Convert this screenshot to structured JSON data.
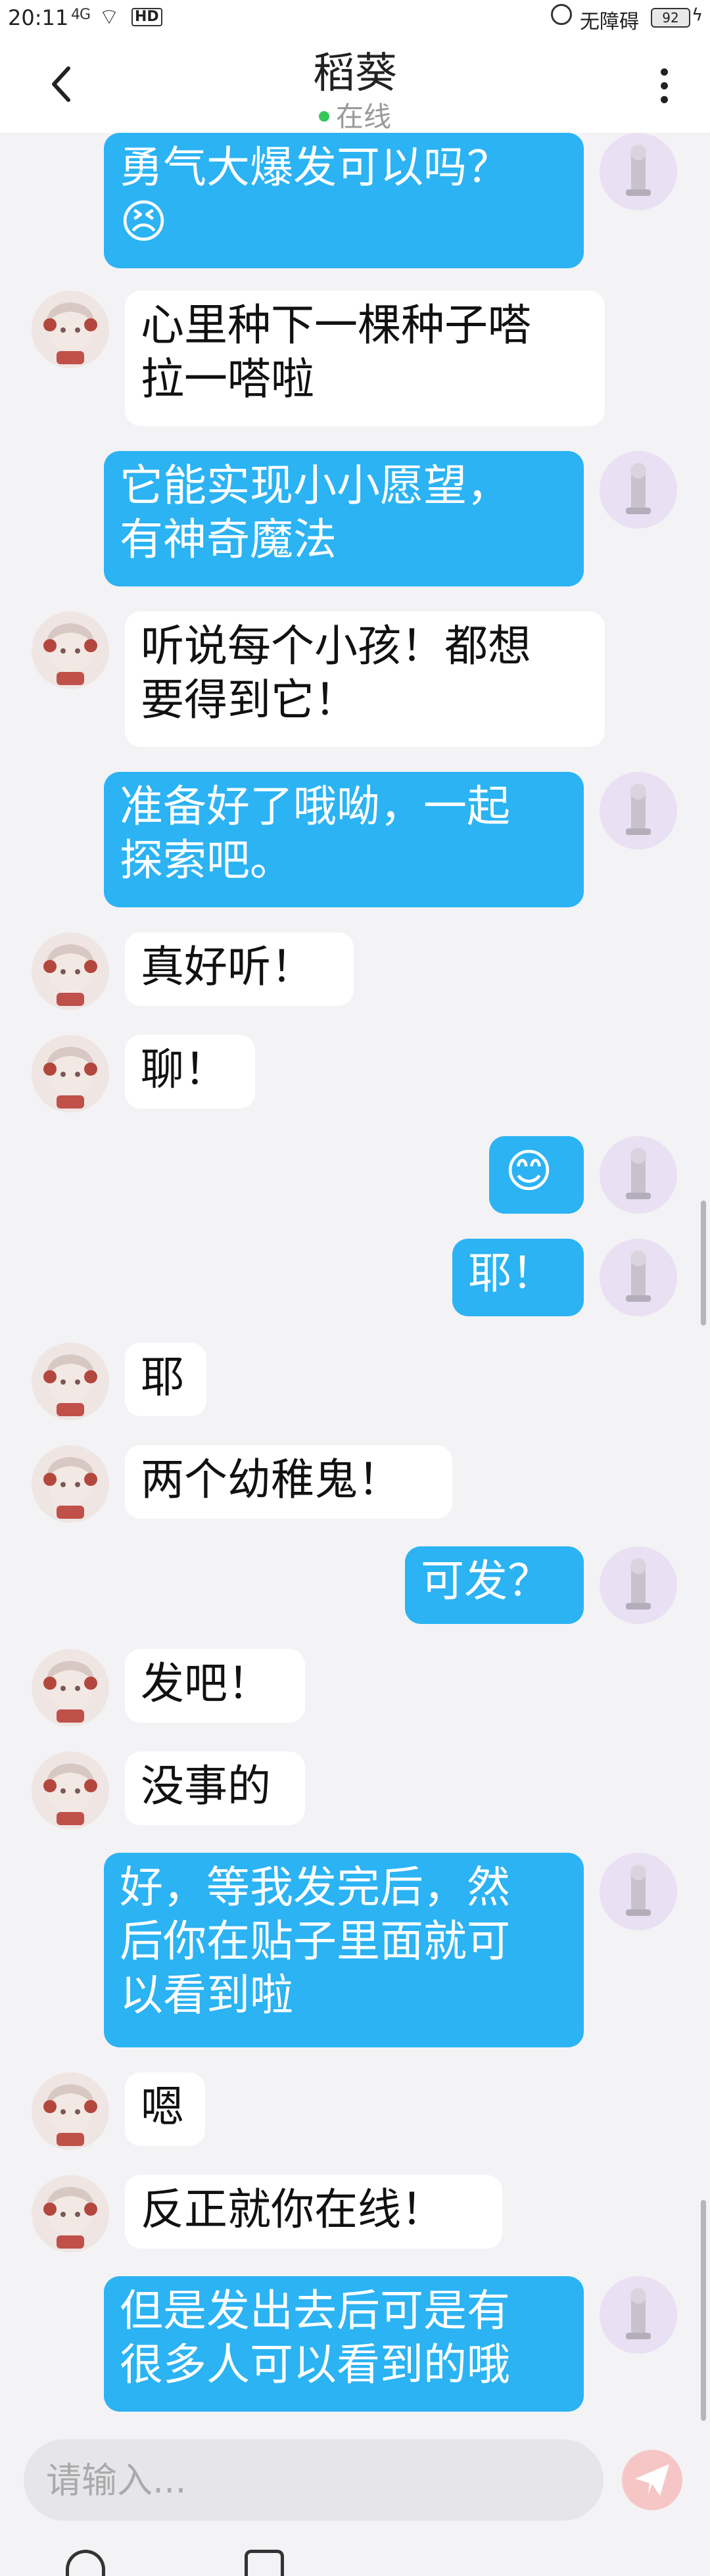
{
  "status_bar": {
    "time": "20:11",
    "signal": "4G",
    "hd": "HD",
    "accessibility_label": "无障碍",
    "battery": "92"
  },
  "header": {
    "contact_name": "稻葵",
    "online_status": "在线"
  },
  "messages": [
    {
      "side": "out",
      "lines": [
        "勇气大爆发可以吗？",
        "😣"
      ]
    },
    {
      "side": "in",
      "lines": [
        "心里种下一棵种子嗒",
        "拉一嗒啦"
      ]
    },
    {
      "side": "out",
      "lines": [
        "它能实现小小愿望，",
        "有神奇魔法"
      ]
    },
    {
      "side": "in",
      "lines": [
        "听说每个小孩！都想",
        "要得到它！"
      ]
    },
    {
      "side": "out",
      "lines": [
        "准备好了哦呦，一起",
        "探索吧。"
      ]
    },
    {
      "side": "in",
      "lines": [
        "真好听！"
      ]
    },
    {
      "side": "in",
      "lines": [
        "聊！"
      ]
    },
    {
      "side": "out",
      "lines": [
        "😊"
      ]
    },
    {
      "side": "out",
      "lines": [
        "耶！"
      ]
    },
    {
      "side": "in",
      "lines": [
        "耶"
      ]
    },
    {
      "side": "in",
      "lines": [
        "两个幼稚鬼！"
      ]
    },
    {
      "side": "out",
      "lines": [
        "可发？"
      ]
    },
    {
      "side": "in",
      "lines": [
        "发吧！"
      ]
    },
    {
      "side": "in",
      "lines": [
        "没事的"
      ]
    },
    {
      "side": "out",
      "lines": [
        "好，等我发完后，然",
        "后你在贴子里面就可",
        "以看到啦"
      ]
    },
    {
      "side": "in",
      "lines": [
        "嗯"
      ]
    },
    {
      "side": "in",
      "lines": [
        "反正就你在线！"
      ]
    },
    {
      "side": "out",
      "lines": [
        "但是发出去后可是有",
        "很多人可以看到的哦"
      ]
    }
  ],
  "input": {
    "placeholder": "请输入..."
  },
  "colors": {
    "outgoing_bubble": "#2bb3f3",
    "incoming_bubble": "#ffffff",
    "background": "#f3f3f6",
    "online_dot": "#35c759"
  }
}
